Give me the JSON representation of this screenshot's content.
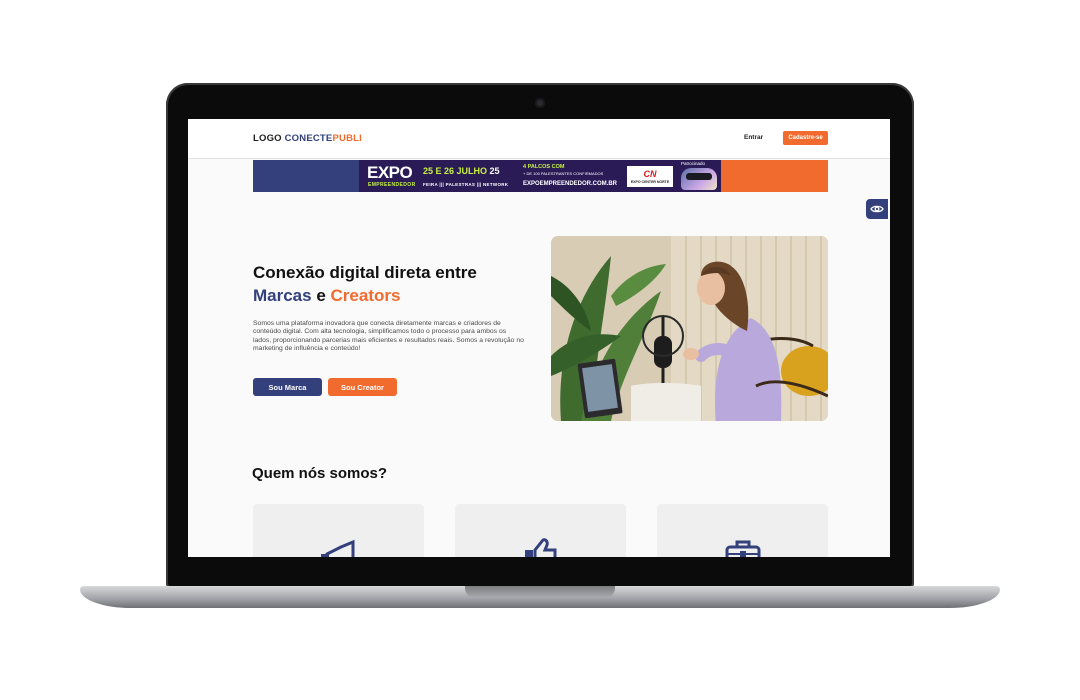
{
  "header": {
    "logo_part1": "LOGO ",
    "logo_part2": "CONECTE",
    "logo_part3": "PUBLI",
    "login_label": "Entrar",
    "signup_label": "Cadastre-se"
  },
  "banner": {
    "brand": "EXPO",
    "brand_sub": "EMPREENDEDOR",
    "dates": "25 E 26 JULHO",
    "year": "25",
    "dates_sub": "FEIRA  |||  PALESTRAS  |||  NETWORK",
    "stages": "4 PALCOS COM",
    "stages_sub": "+ DE 100 PALESTRANTES CONFIRMADOS",
    "site": "EXPOEMPREENDEDOR.COM.BR",
    "partner_mark": "CN",
    "partner_name": "EXPO CENTER NORTE",
    "sponsored": "Patrocinado"
  },
  "hero": {
    "title_line1": "Conexão digital direta entre",
    "title_brands": "Marcas",
    "title_and": " e ",
    "title_creators": "Creators",
    "description": "Somos uma plataforma inovadora que conecta diretamente marcas e criadores de conteúdo digital. Com alta tecnologia, simplificamos todo o processo para ambos os lados, proporcionando parcerias mais eficientes e resultados reais. Somos a revolução no marketing de influência e conteúdo!",
    "btn_brand": "Sou Marca",
    "btn_creator": "Sou Creator"
  },
  "about": {
    "title": "Quem nós somos?"
  },
  "icons": {
    "accessibility": "eye-icon",
    "card1": "megaphone-icon",
    "card2": "thumbs-up-icon",
    "card3": "briefcase-icon"
  },
  "colors": {
    "brand_blue": "#33407c",
    "brand_orange": "#f26b2e",
    "banner_purple": "#2a1b56",
    "banner_lime": "#c7f23c"
  }
}
